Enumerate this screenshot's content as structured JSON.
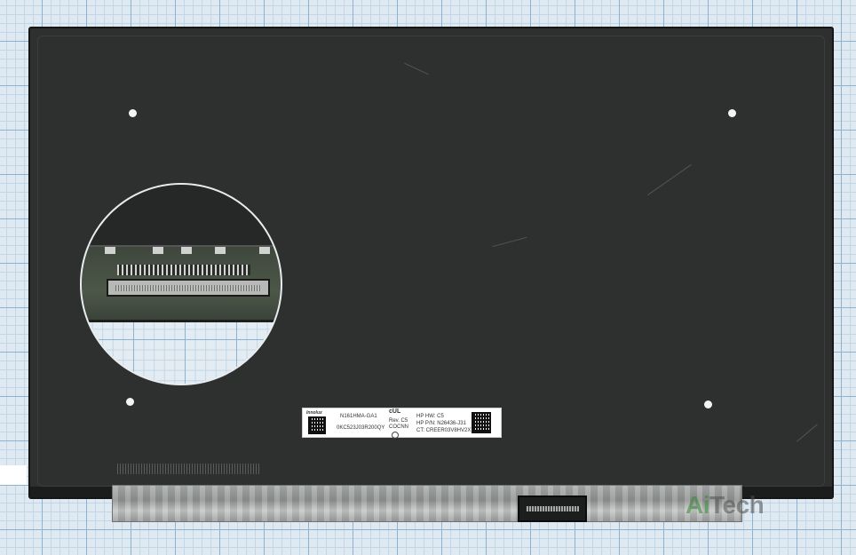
{
  "label": {
    "brand": "Innolux",
    "model": "N161HMA-GA1",
    "serial": "0KC523J03R200QY",
    "rev": "Rev. C5",
    "code": "COCNN",
    "hp_hw": "HP HW: C5",
    "hp_pn": "HP P/N: N26436-J31",
    "ct": "CT: CREER03V8HV2X7",
    "cert_mark": "cUL"
  },
  "watermark": {
    "prefix": "Ai",
    "suffix": "Tech"
  }
}
